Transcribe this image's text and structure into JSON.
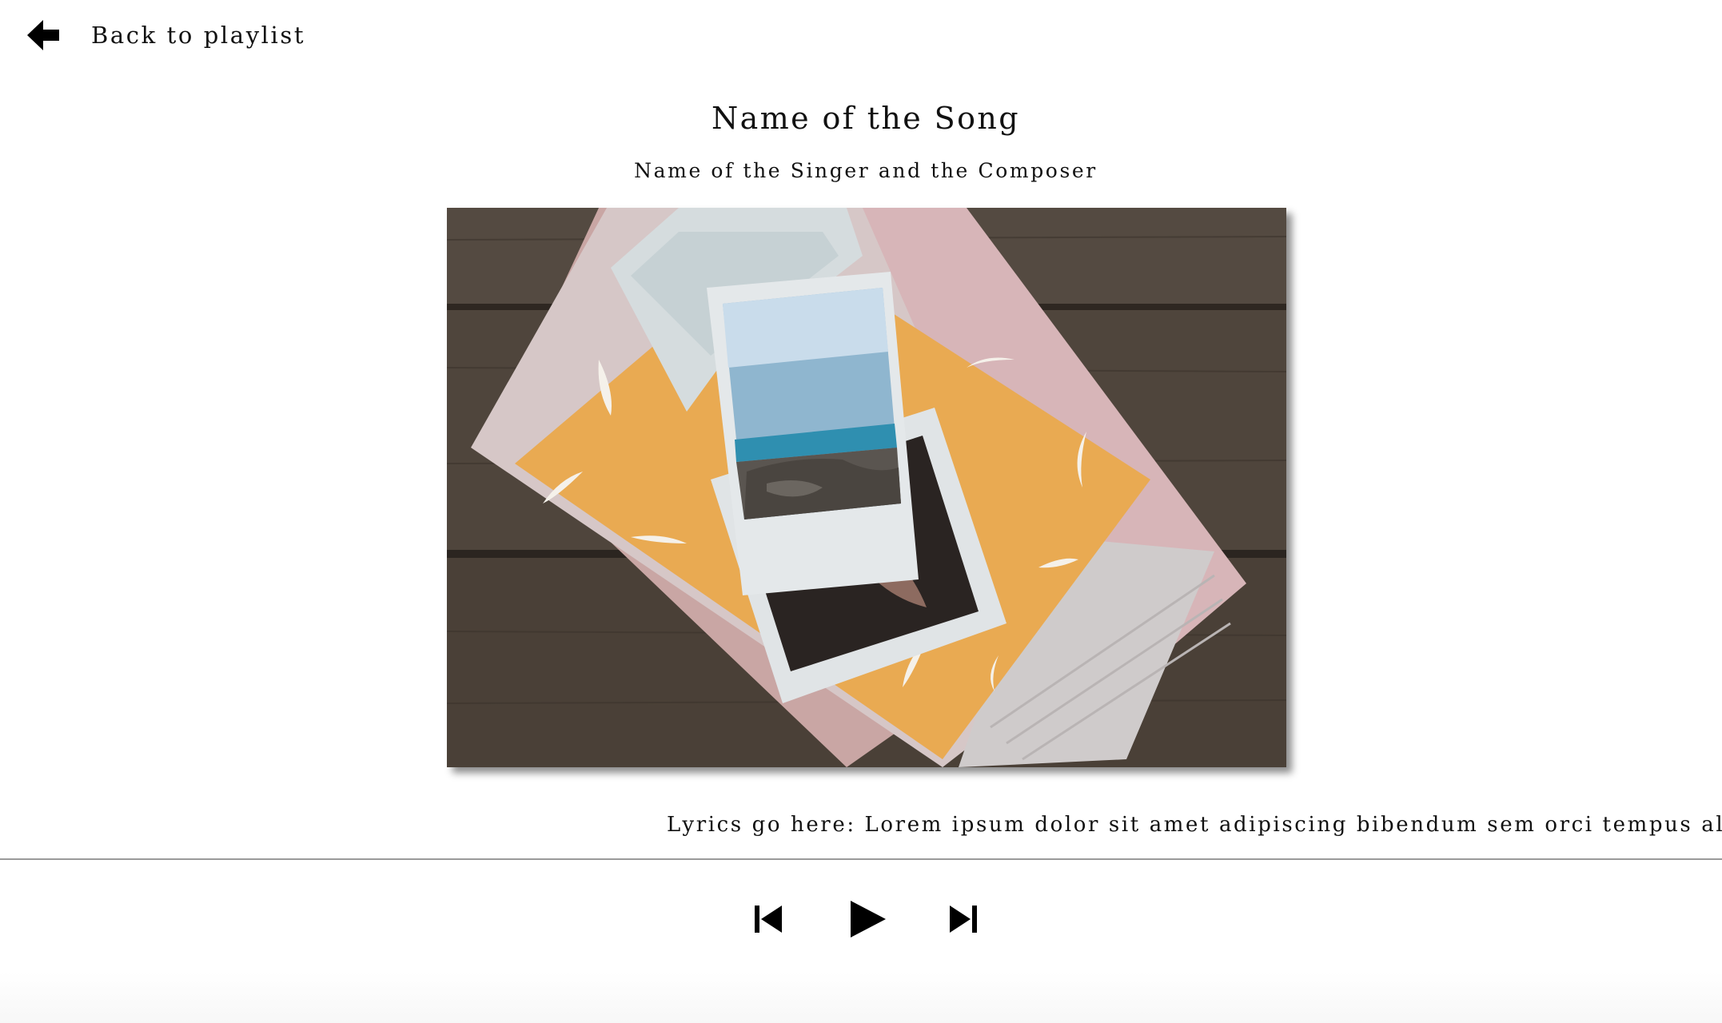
{
  "nav": {
    "back_label": "Back to playlist",
    "back_icon": "arrow-left-icon"
  },
  "song": {
    "title": "Name of the Song",
    "artist_line": "Name of the Singer and the Composer",
    "lyrics": "Lyrics go here: Lorem ipsum dolor sit amet adipiscing bibendum sem orci tempus aliquet gravida,",
    "album_art_alt": "Album artwork"
  },
  "player": {
    "prev_icon": "skip-previous-icon",
    "play_icon": "play-icon",
    "next_icon": "skip-next-icon"
  },
  "colors": {
    "text": "#111111",
    "divider": "#9a9a9a",
    "background": "#ffffff"
  }
}
